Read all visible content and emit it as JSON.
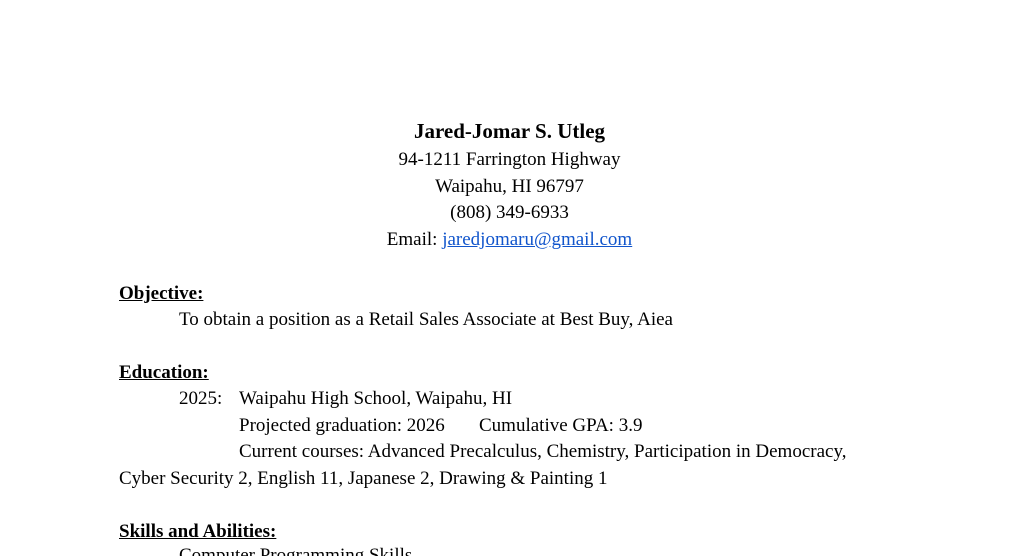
{
  "header": {
    "name": "Jared-Jomar S. Utleg",
    "address_line1": "94-1211 Farrington Highway",
    "address_line2": "Waipahu, HI 96797",
    "phone": "(808) 349-6933",
    "email_label": "Email: ",
    "email": "jaredjomaru@gmail.com",
    "link_color": "#1155cc"
  },
  "objective": {
    "heading": "Objective:",
    "text": "To obtain a position as a Retail Sales Associate at Best Buy, Aiea"
  },
  "education": {
    "heading": "Education:",
    "year": "2025:",
    "school": "Waipahu High School, Waipahu, HI",
    "graduation": "Projected graduation: 2026",
    "gpa": "Cumulative GPA: 3.9",
    "courses_line1": "Current courses: Advanced Precalculus, Chemistry, Participation in Democracy,",
    "courses_line2": "Cyber Security 2, English 11, Japanese 2, Drawing & Painting 1"
  },
  "skills": {
    "heading": "Skills and Abilities:",
    "first_item": "Computer Programming Skills"
  }
}
